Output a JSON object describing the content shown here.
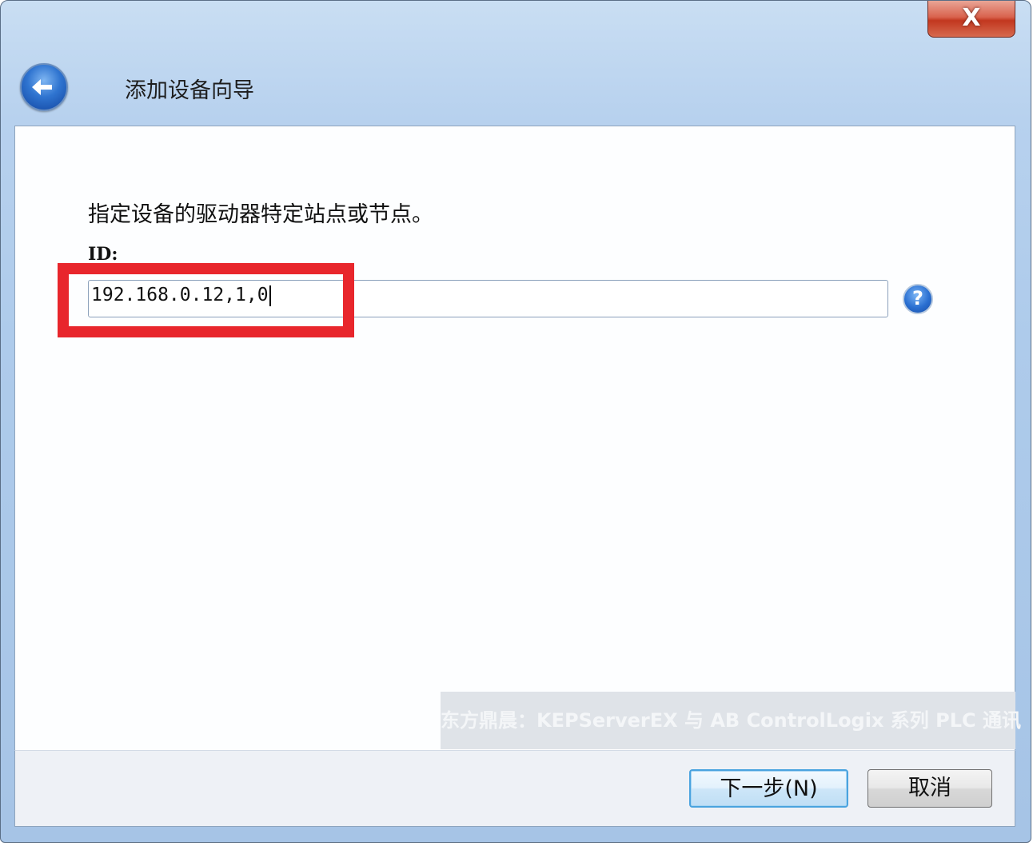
{
  "window": {
    "title": "添加设备向导",
    "close_label": "X"
  },
  "content": {
    "instruction": "指定设备的驱动器特定站点或节点。",
    "id_label": "ID:",
    "id_value": "192.168.0.12,1,0",
    "help_label": "?"
  },
  "watermark": "东方鼎晨：KEPServerEX 与 AB ControlLogix 系列 PLC 通讯",
  "footer": {
    "next_label": "下一步(N)",
    "cancel_label": "取消"
  },
  "colors": {
    "highlight": "#e8262c",
    "title_bar": "#b7d1ee",
    "close_button": "#c2371f"
  }
}
